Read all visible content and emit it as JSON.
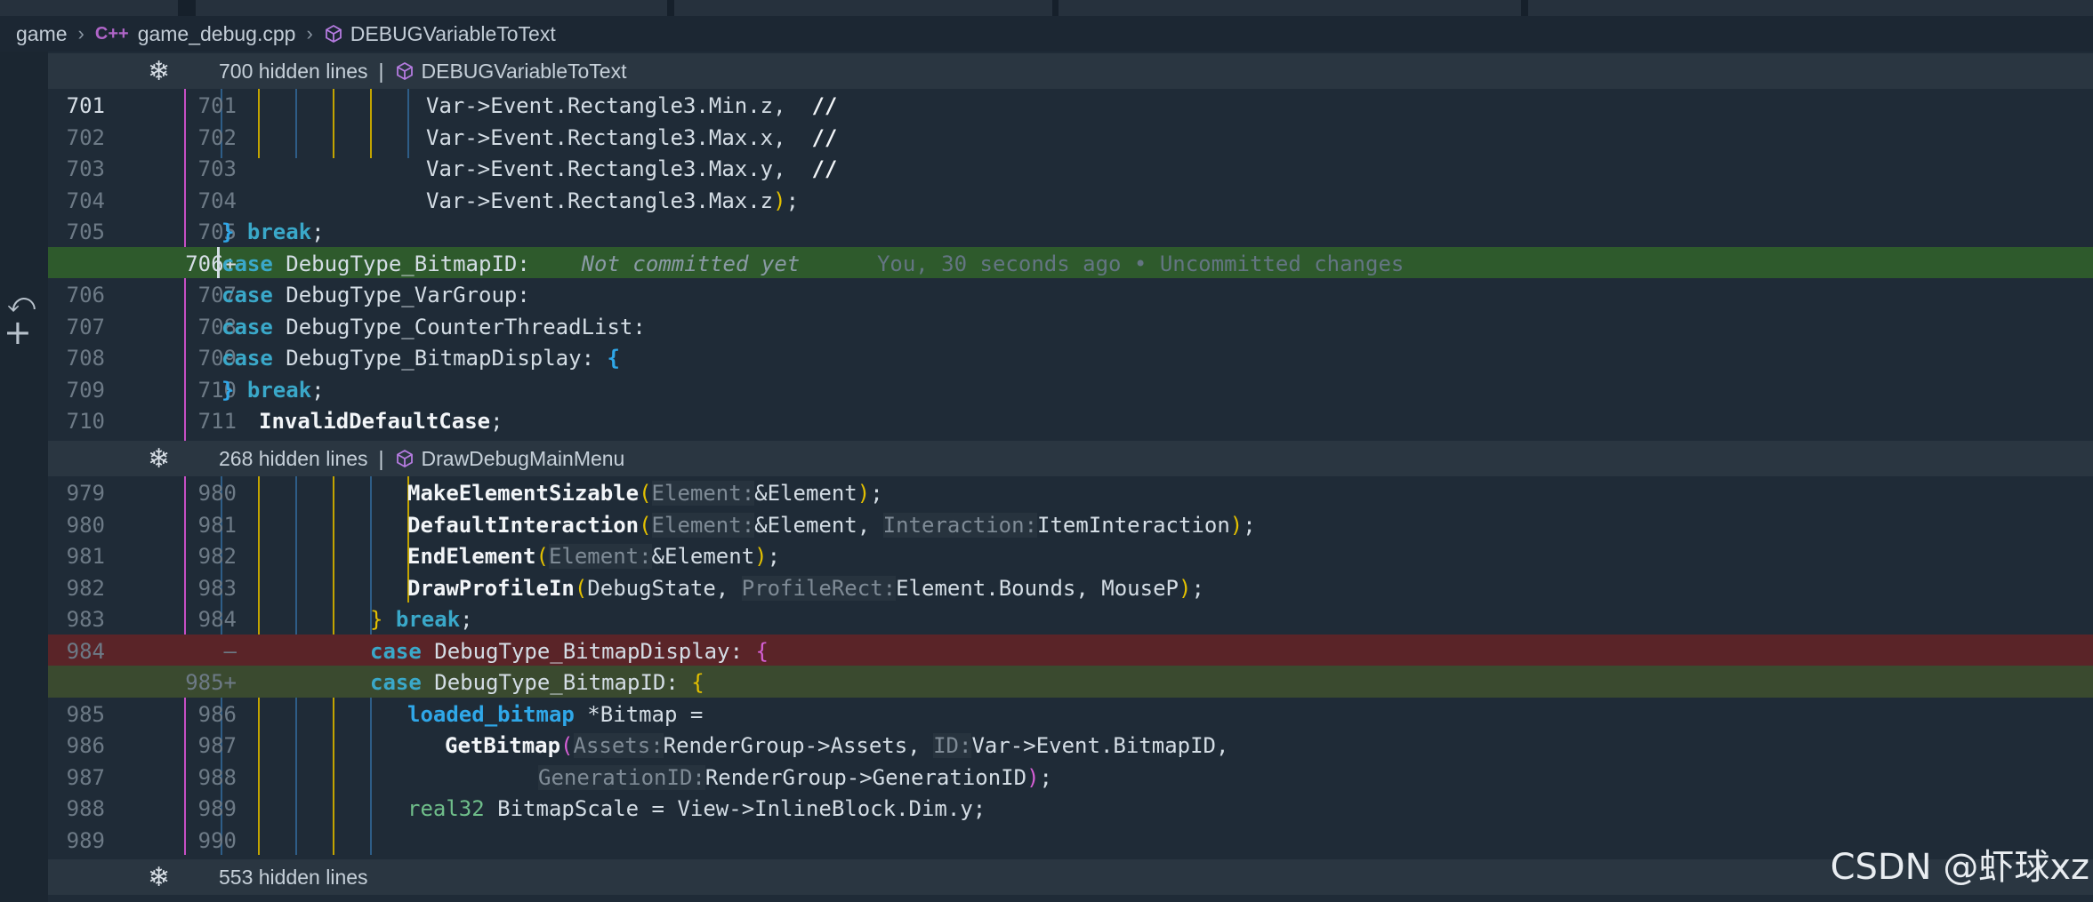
{
  "breadcrumb": {
    "folder": "game",
    "file_icon": "C++",
    "file": "game_debug.cpp",
    "symbol": "DEBUGVariableToText"
  },
  "folds": [
    {
      "text": "700 hidden lines",
      "symbol": "DEBUGVariableToText"
    },
    {
      "text": "268 hidden lines",
      "symbol": "DrawDebugMainMenu"
    },
    {
      "text": "553 hidden lines",
      "symbol": ""
    }
  ],
  "icons": {
    "fold": "snowflake-icon",
    "symbol": "cube-icon",
    "revert": "undo-icon",
    "add": "plus-icon"
  },
  "section1": [
    {
      "l": "701",
      "r": "701"
    },
    {
      "l": "702",
      "r": "702"
    },
    {
      "l": "703",
      "r": "703"
    },
    {
      "l": "704",
      "r": "704"
    },
    {
      "l": "705",
      "r": "705"
    },
    {
      "l": "",
      "r": "706+"
    },
    {
      "l": "706",
      "r": "707"
    },
    {
      "l": "707",
      "r": "708"
    },
    {
      "l": "708",
      "r": "709"
    },
    {
      "l": "709",
      "r": "710"
    },
    {
      "l": "710",
      "r": "711"
    }
  ],
  "section2": [
    {
      "l": "979",
      "r": "980"
    },
    {
      "l": "980",
      "r": "981"
    },
    {
      "l": "981",
      "r": "982"
    },
    {
      "l": "982",
      "r": "983"
    },
    {
      "l": "983",
      "r": "984"
    },
    {
      "l": "984",
      "r": "—"
    },
    {
      "l": "",
      "r": "985+"
    },
    {
      "l": "985",
      "r": "986"
    },
    {
      "l": "986",
      "r": "987"
    },
    {
      "l": "987",
      "r": "988"
    },
    {
      "l": "988",
      "r": "989"
    },
    {
      "l": "989",
      "r": "990"
    }
  ],
  "code": {
    "c701": "Var->Event.Rectangle3.Min.z,",
    "c702": "Var->Event.Rectangle3.Max.x,",
    "c703": "Var->Event.Rectangle3.Max.y,",
    "c704a": "Var->Event.Rectangle3.Max.z",
    "comment": "//",
    "close_brace": "}",
    "break": "break",
    "case": "case",
    "bitmap_id": "DebugType_BitmapID:",
    "blame_a": "Not committed yet",
    "blame_b": "You, 30 seconds ago • Uncommitted changes",
    "var_group": "DebugType_VarGroup:",
    "counter_list": "DebugType_CounterThreadList:",
    "bitmap_display": "DebugType_BitmapDisplay:",
    "open_brace": "{",
    "invalid_default": "InvalidDefaultCase",
    "make_sizable": "MakeElementSizable",
    "default_interaction": "DefaultInteraction",
    "end_element": "EndElement",
    "draw_profile": "DrawProfileIn",
    "hint_element": "Element:",
    "hint_interaction": "Interaction:",
    "hint_profile_rect": "ProfileRect:",
    "hint_assets": "Assets:",
    "hint_id": "ID:",
    "hint_generation_id": "GenerationID:",
    "amp_element": "&Element",
    "item_interaction": "ItemInteraction",
    "debug_state": "DebugState,",
    "element_bounds": "Element.Bounds, MouseP",
    "bitmap_display_case": "DebugType_BitmapDisplay:",
    "bitmap_id_case": "DebugType_BitmapID:",
    "loaded_bitmap": "loaded_bitmap",
    "ptr_bitmap": "*Bitmap =",
    "get_bitmap": "GetBitmap",
    "rg_assets": "RenderGroup->Assets,",
    "var_bitmap_id": "Var->Event.BitmapID,",
    "rg_generation": "RenderGroup->GenerationID",
    "real32": "real32",
    "bitmap_scale": "BitmapScale = View->InlineBlock.Dim.y;"
  },
  "watermark": "CSDN @虾球xz"
}
